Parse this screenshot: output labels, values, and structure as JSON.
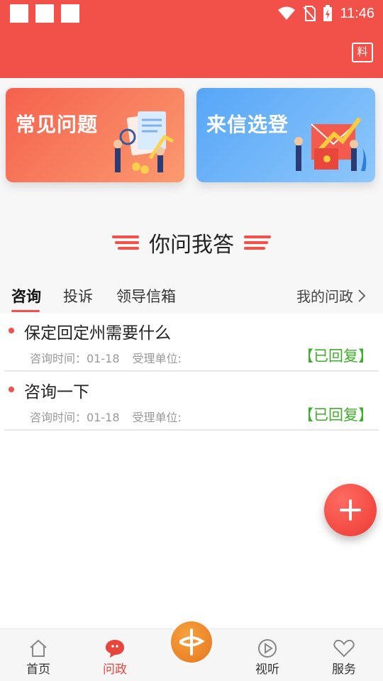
{
  "status_bar": {
    "time": "11:46"
  },
  "header": {
    "icon_glyph": "料",
    "icon_name": "news-feed-icon"
  },
  "banners": {
    "faq": {
      "title": "常见问题"
    },
    "letters": {
      "title": "来信选登"
    }
  },
  "section": {
    "title": "你问我答"
  },
  "tabs": {
    "items": [
      {
        "label": "咨询"
      },
      {
        "label": "投诉"
      },
      {
        "label": "领导信箱"
      }
    ],
    "my_policy": "我的问政"
  },
  "list": [
    {
      "title": "保定回定州需要什么",
      "time_label": "咨询时间：01-18",
      "dept_label": "受理单位:",
      "status": "【已回复】"
    },
    {
      "title": "咨询一下",
      "time_label": "咨询时间：01-18",
      "dept_label": "受理单位:",
      "status": "【已回复】"
    }
  ],
  "bottom_nav": {
    "home": "首页",
    "ask": "问政",
    "video": "视听",
    "service": "服务"
  },
  "colors": {
    "accent": "#f2514a",
    "replied": "#3fae2a",
    "center_logo": "#e6751f"
  }
}
